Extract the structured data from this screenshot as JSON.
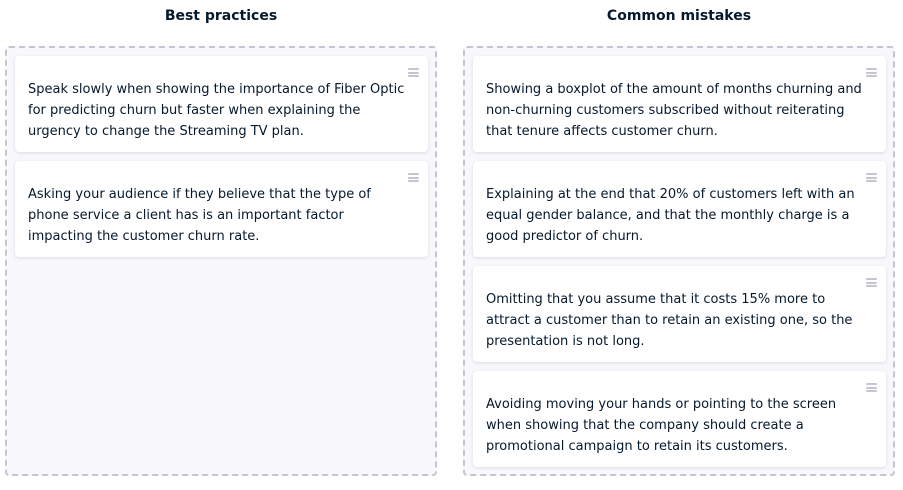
{
  "best_practices": {
    "title": "Best practices",
    "cards": [
      "Speak slowly when showing the importance of Fiber Optic for predicting churn but faster when explaining the urgency to change the Streaming TV plan.",
      "Asking your audience if they believe that the type of phone service a client has is an important factor impacting the customer churn rate."
    ]
  },
  "common_mistakes": {
    "title": "Common mistakes",
    "cards": [
      "Showing a boxplot of the amount of months churning and non-churning customers subscribed without reiterating that tenure affects customer churn.",
      "Explaining at the end that 20% of customers left with an equal gender balance, and that the monthly charge is a good predictor of churn.",
      "Omitting that you assume that it costs 15% more to attract a customer than to retain an existing one, so the presentation is not long.",
      "Avoiding moving your hands or pointing to the screen when showing that the company should create a promotional campaign to retain its customers."
    ]
  },
  "icons": {
    "drag_handle": "drag-handle-icon"
  },
  "colors": {
    "text": "#05192d",
    "dropzone_border": "#c4c5d1",
    "dropzone_bg": "#f7f7fc",
    "card_bg": "#ffffff"
  }
}
